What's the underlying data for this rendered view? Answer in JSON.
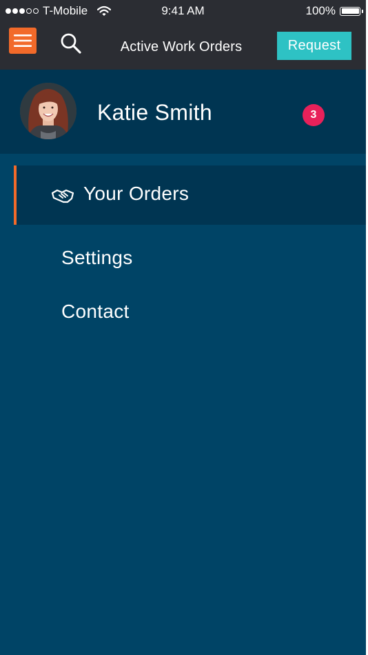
{
  "status_bar": {
    "carrier": "T-Mobile",
    "time": "9:41 AM",
    "battery": "100%",
    "signal_bars_filled": 3,
    "signal_bars_total": 5
  },
  "nav": {
    "title": "Active Work Orders",
    "request_label": "Request",
    "icons": {
      "menu": "hamburger-menu-icon",
      "search": "search-icon"
    }
  },
  "profile": {
    "name": "Katie Smith",
    "badge_count": "3"
  },
  "menu": {
    "items": [
      {
        "label": "Your Orders",
        "icon": "handshake-icon",
        "active": true
      },
      {
        "label": "Settings",
        "active": false
      },
      {
        "label": "Contact",
        "active": false
      }
    ]
  },
  "colors": {
    "accent": "#f26a2a",
    "request_button": "#2ec2c4",
    "badge": "#e8215a",
    "background": "#004466",
    "panel": "#003552",
    "topbar": "#2b2d33"
  }
}
